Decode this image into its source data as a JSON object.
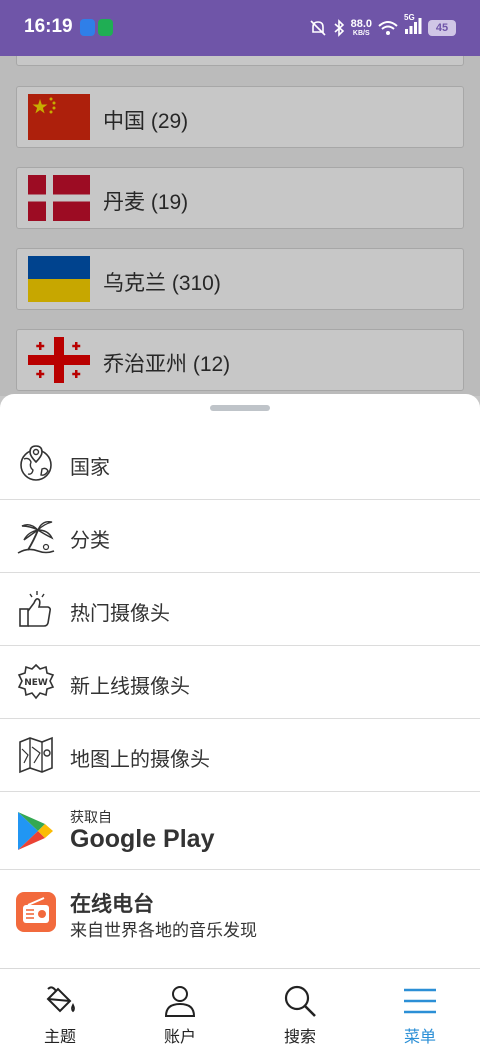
{
  "status_bar": {
    "time": "16:19",
    "net_speed": "88.0",
    "net_unit": "KB/S",
    "signal_label": "5G",
    "battery": "45"
  },
  "countries": [
    {
      "name": "中国 (29)",
      "flag": "china-flag"
    },
    {
      "name": "丹麦 (19)",
      "flag": "denmark-flag"
    },
    {
      "name": "乌克兰 (310)",
      "flag": "ukraine-flag"
    },
    {
      "name": "乔治亚州 (12)",
      "flag": "georgia-flag"
    }
  ],
  "menu": {
    "items": [
      {
        "label": "国家",
        "icon": "globe-pin-icon"
      },
      {
        "label": "分类",
        "icon": "palm-beach-icon"
      },
      {
        "label": "热门摄像头",
        "icon": "thumbs-up-icon"
      },
      {
        "label": "新上线摄像头",
        "icon": "new-badge-icon"
      },
      {
        "label": "地图上的摄像头",
        "icon": "map-icon"
      }
    ],
    "google_play": {
      "small": "获取自",
      "big": "Google Play"
    },
    "radio_app": {
      "title": "在线电台",
      "subtitle": "来自世界各地的音乐发现"
    }
  },
  "bottom_nav": [
    {
      "label": "主题",
      "icon": "paint-bucket-icon"
    },
    {
      "label": "账户",
      "icon": "user-icon"
    },
    {
      "label": "搜索",
      "icon": "search-icon"
    },
    {
      "label": "菜单",
      "icon": "menu-icon",
      "active": true
    }
  ],
  "colors": {
    "status_bar": "#6f55a8",
    "accent": "#2b8fd6",
    "radio_icon": "#f26a3d"
  }
}
